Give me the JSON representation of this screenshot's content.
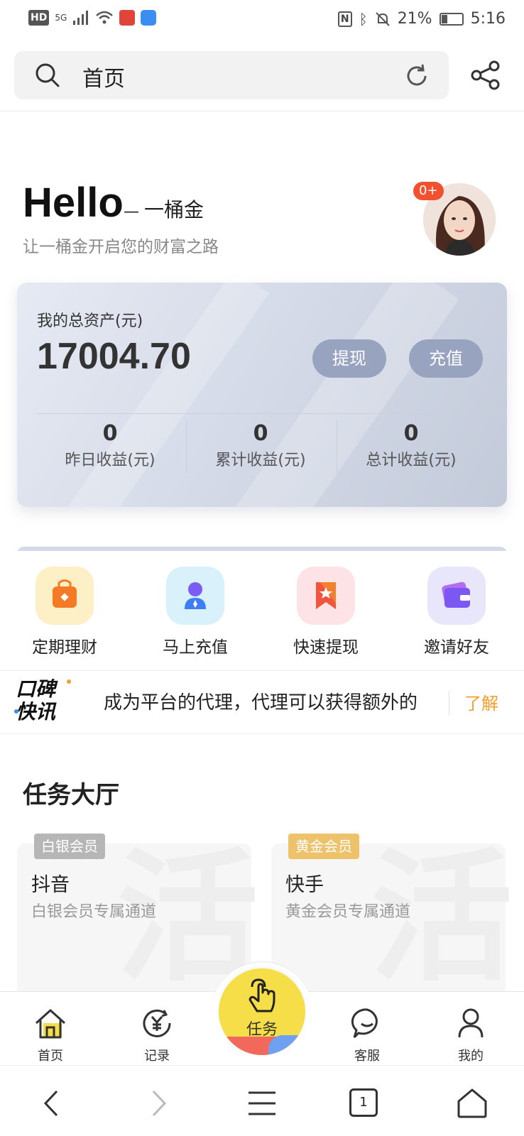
{
  "status_bar": {
    "network_hd": "HD",
    "network_5g": "5G",
    "battery": "21%",
    "time": "5:16"
  },
  "search": {
    "title": "首页"
  },
  "hero": {
    "greeting": "Hello",
    "brand": "一桶金",
    "tagline": "让一桶金开启您的财富之路",
    "notification_badge": "0+"
  },
  "asset_card": {
    "label": "我的总资产(元)",
    "value": "17004.70",
    "withdraw_label": "提现",
    "recharge_label": "充值",
    "stats": [
      {
        "value": "0",
        "label": "昨日收益(元)"
      },
      {
        "value": "0",
        "label": "累计收益(元)"
      },
      {
        "value": "0",
        "label": "总计收益(元)"
      }
    ]
  },
  "quick_actions": [
    {
      "label": "定期理财",
      "icon": "bag-icon",
      "bg": "#fdf0c6",
      "fg": "#f57a26"
    },
    {
      "label": "马上充值",
      "icon": "user-icon",
      "bg": "#d8f1fb",
      "fg": "#4b6df5"
    },
    {
      "label": "快速提现",
      "icon": "bookmark-star-icon",
      "bg": "#fde3e6",
      "fg": "#f0553d"
    },
    {
      "label": "邀请好友",
      "icon": "wallet-icon",
      "bg": "#e8e6fb",
      "fg": "#7d57f2"
    }
  ],
  "news": {
    "logo_line1": "口碑",
    "logo_line2": "快讯",
    "text": "成为平台的代理，代理可以获得额外的",
    "more_label": "了解"
  },
  "task_hall": {
    "title": "任务大厅",
    "tasks": [
      {
        "tier": "白银会员",
        "tier_color": "#b6b6b6",
        "name": "抖音",
        "desc": "白银会员专属通道"
      },
      {
        "tier": "黄金会员",
        "tier_color": "#edc26a",
        "name": "快手",
        "desc": "黄金会员专属通道"
      }
    ]
  },
  "tabbar": {
    "home": "首页",
    "records": "记录",
    "tasks": "任务",
    "service": "客服",
    "mine": "我的"
  },
  "browser_nav": {
    "tab_count": "1"
  },
  "colors": {
    "accent_yellow": "#f6de48",
    "link_orange": "#f0a02a",
    "pill_blue": "#97a3bf"
  }
}
